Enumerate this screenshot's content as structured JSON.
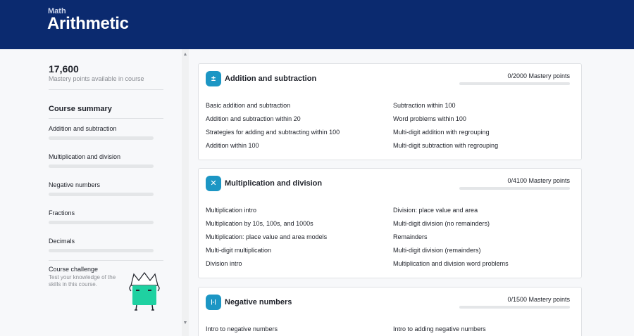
{
  "header": {
    "kicker": "Math",
    "title": "Arithmetic"
  },
  "sidebar": {
    "points_value": "17,600",
    "points_label": "Mastery points available in course",
    "summary_title": "Course summary",
    "items": [
      {
        "label": "Addition and subtraction",
        "progress": 0
      },
      {
        "label": "Multiplication and division",
        "progress": 0
      },
      {
        "label": "Negative numbers",
        "progress": 0
      },
      {
        "label": "Fractions",
        "progress": 0
      },
      {
        "label": "Decimals",
        "progress": 0
      }
    ],
    "challenge": {
      "title": "Course challenge",
      "description": "Test your knowledge of the skills in this course."
    }
  },
  "units": [
    {
      "title": "Addition and subtraction",
      "icon": "plus-minus-icon",
      "mastery": "0/2000 Mastery points",
      "progress": 0,
      "lessons_left": [
        "Basic addition and subtraction",
        "Addition and subtraction within 20",
        "Strategies for adding and subtracting within 100",
        "Addition within 100"
      ],
      "lessons_right": [
        "Subtraction within 100",
        "Word problems within 100",
        "Multi-digit addition with regrouping",
        "Multi-digit subtraction with regrouping"
      ]
    },
    {
      "title": "Multiplication and division",
      "icon": "times-divide-icon",
      "mastery": "0/4100 Mastery points",
      "progress": 0,
      "lessons_left": [
        "Multiplication intro",
        "Multiplication by 10s, 100s, and 1000s",
        "Multiplication: place value and area models",
        "Multi-digit multiplication",
        "Division intro"
      ],
      "lessons_right": [
        "Division: place value and area",
        "Multi-digit division (no remainders)",
        "Remainders",
        "Multi-digit division (remainders)",
        "Multiplication and division word problems"
      ]
    },
    {
      "title": "Negative numbers",
      "icon": "absolute-value-icon",
      "mastery": "0/1500 Mastery points",
      "progress": 0,
      "lessons_left": [
        "Intro to negative numbers"
      ],
      "lessons_right": [
        "Intro to adding negative numbers"
      ]
    }
  ],
  "colors": {
    "header_bg": "#0b2a6f",
    "icon_bg": "#1c96c4",
    "mascot": "#1fd1a1"
  }
}
